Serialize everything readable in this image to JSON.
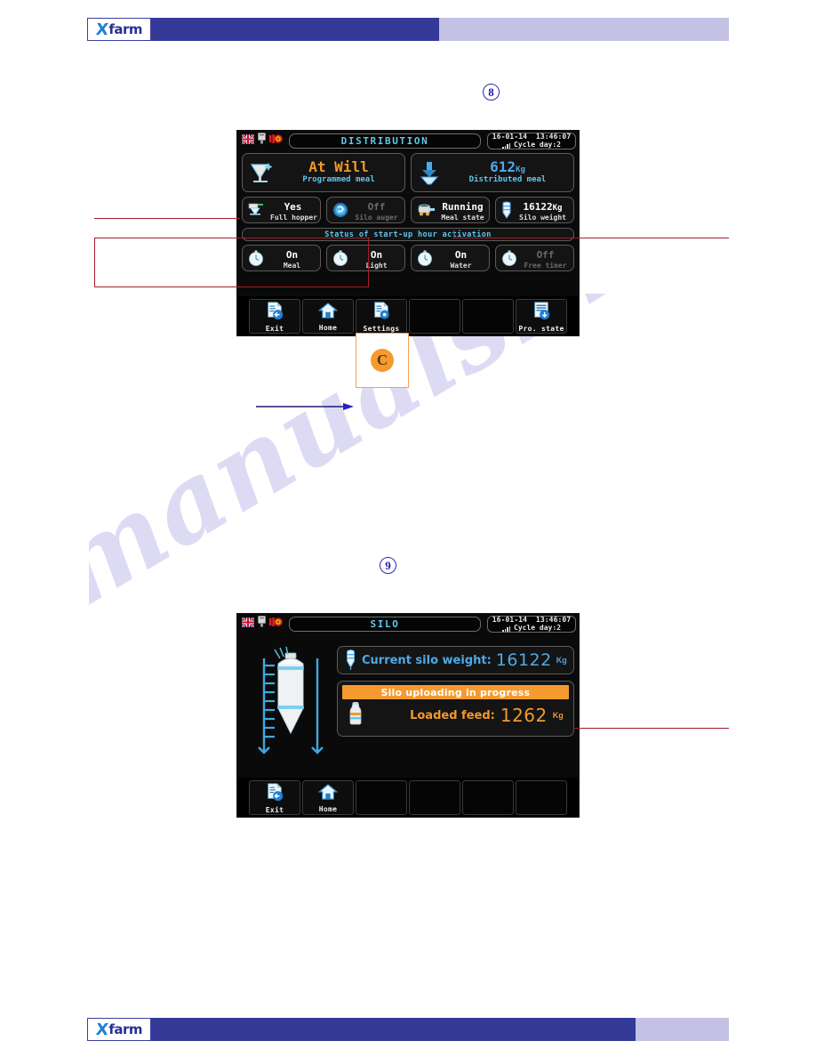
{
  "brand": {
    "logo_x": "X",
    "logo_text": "farm"
  },
  "watermark": {
    "text": "manualshive.com"
  },
  "step_badges": [
    {
      "label": "8"
    },
    {
      "label": "9"
    }
  ],
  "callout_c": {
    "label": "C"
  },
  "screen1": {
    "header": {
      "title": "DISTRIBUTION",
      "date": "16-01-14",
      "time": "13:46:07",
      "cycle": "Cycle day:2",
      "icons": [
        "uk-flag-icon",
        "usb-icon",
        "alarm-icon"
      ]
    },
    "big_tiles": [
      {
        "icon": "hopper-icon",
        "value": "At Will",
        "unit": "",
        "label": "Programmed meal",
        "value_color": "#f3992b"
      },
      {
        "icon": "distribute-arrow-icon",
        "value": "612",
        "unit": "Kg",
        "label": "Distributed meal",
        "value_color": "#4ea9e8"
      }
    ],
    "small_tiles": [
      {
        "icon": "hopper-full-icon",
        "value": "Yes",
        "unit": "",
        "label": "Full hopper",
        "state": "on"
      },
      {
        "icon": "auger-icon",
        "value": "Off",
        "unit": "",
        "label": "Silo auger",
        "state": "off"
      },
      {
        "icon": "motor-icon",
        "value": "Running",
        "unit": "",
        "label": "Meal state",
        "state": "on"
      },
      {
        "icon": "silo-icon",
        "value": "16122",
        "unit": "Kg",
        "label": "Silo weight",
        "state": "on"
      }
    ],
    "section_title": "Status of start-up hour activation",
    "timer_tiles": [
      {
        "icon": "clock-icon",
        "value": "On",
        "label": "Meal",
        "state": "on"
      },
      {
        "icon": "clock-icon",
        "value": "On",
        "label": "Light",
        "state": "on"
      },
      {
        "icon": "clock-icon",
        "value": "On",
        "label": "Water",
        "state": "on"
      },
      {
        "icon": "clock-icon",
        "value": "Off",
        "label": "Free timer",
        "state": "off"
      }
    ],
    "toolbar": [
      {
        "icon": "exit-doc-icon",
        "label": "Exit"
      },
      {
        "icon": "home-icon",
        "label": "Home"
      },
      {
        "icon": "settings-doc-icon",
        "label": "Settings"
      },
      {
        "icon": "",
        "label": ""
      },
      {
        "icon": "",
        "label": ""
      },
      {
        "icon": "prog-state-doc-icon",
        "label": "Pro. state"
      }
    ]
  },
  "screen2": {
    "header": {
      "title": "SILO",
      "date": "16-01-14",
      "time": "13:46:07",
      "cycle": "Cycle day:2",
      "icons": [
        "uk-flag-icon",
        "usb-icon",
        "alarm-icon"
      ]
    },
    "current_weight": {
      "icon": "silo-small-icon",
      "label": "Current silo weight:",
      "value": "16122",
      "unit": "Kg"
    },
    "status_banner": "Silo uploading in progress",
    "loaded_feed": {
      "icon": "feed-bag-icon",
      "label": "Loaded feed:",
      "value": "1262",
      "unit": "Kg"
    },
    "toolbar": [
      {
        "icon": "exit-doc-icon",
        "label": "Exit"
      },
      {
        "icon": "home-icon",
        "label": "Home"
      },
      {
        "icon": "",
        "label": ""
      },
      {
        "icon": "",
        "label": ""
      },
      {
        "icon": "",
        "label": ""
      },
      {
        "icon": "",
        "label": ""
      }
    ]
  },
  "colors": {
    "brand_dark": "#353a99",
    "brand_light": "#c3c2e4",
    "accent_orange": "#f59a2e",
    "accent_blue": "#4ea9e8",
    "leader_red": "#a31d2c",
    "badge_blue": "#1c1ca8"
  }
}
